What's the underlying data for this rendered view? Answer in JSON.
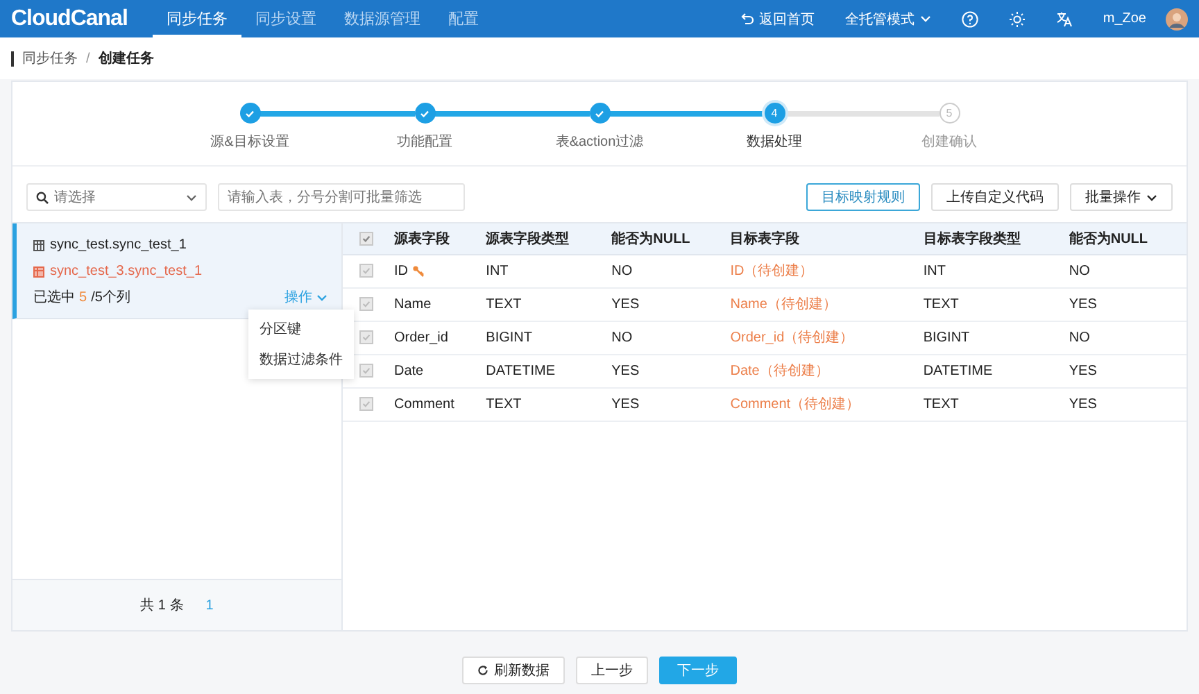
{
  "header": {
    "logo": "CloudCanal",
    "nav": [
      {
        "label": "同步任务",
        "selected": true
      },
      {
        "label": "同步设置",
        "selected": false
      },
      {
        "label": "数据源管理",
        "selected": false
      },
      {
        "label": "配置",
        "selected": false
      }
    ],
    "home_link": "返回首页",
    "mode": "全托管模式",
    "user": "m_Zoe"
  },
  "breadcrumb": {
    "items": [
      "同步任务",
      "创建任务"
    ],
    "separator": "/"
  },
  "steps": [
    {
      "label": "源&目标设置",
      "done": true,
      "selected": false
    },
    {
      "label": "功能配置",
      "done": true,
      "selected": false
    },
    {
      "label": "表&action过滤",
      "done": true,
      "selected": false
    },
    {
      "number": "4",
      "label": "数据处理",
      "done": false,
      "selected": true
    },
    {
      "number": "5",
      "label": "创建确认",
      "done": false,
      "selected": false
    }
  ],
  "toolbar": {
    "select_placeholder": "请选择",
    "filter_placeholder": "请输入表，分号分割可批量筛选",
    "buttons": [
      {
        "label": "目标映射规则",
        "kind": "outline"
      },
      {
        "label": "上传自定义代码",
        "kind": "plain"
      },
      {
        "label": "批量操作",
        "kind": "dropdown"
      }
    ]
  },
  "table_list": [
    {
      "source": "sync_test.sync_test_1",
      "target": "sync_test_3.sync_test_1",
      "selected_prefix": "已选中",
      "selected_count": "5",
      "selected_suffix": "/5个列",
      "action": "操作",
      "selected": true
    }
  ],
  "action_menu": [
    "分区键",
    "数据过滤条件"
  ],
  "pagination": {
    "total": "共 1 条",
    "page": "1"
  },
  "all_checked": true,
  "columns": [
    "源表字段",
    "源表字段类型",
    "能否为NULL",
    "目标表字段",
    "目标表字段类型",
    "能否为NULL"
  ],
  "rows": [
    {
      "checked": true,
      "key": true,
      "cells": [
        "ID",
        "INT",
        "NO",
        "ID（待创建）",
        "INT",
        "NO"
      ]
    },
    {
      "checked": true,
      "key": false,
      "cells": [
        "Name",
        "TEXT",
        "YES",
        "Name（待创建）",
        "TEXT",
        "YES"
      ]
    },
    {
      "checked": true,
      "key": false,
      "cells": [
        "Order_id",
        "BIGINT",
        "NO",
        "Order_id（待创建）",
        "BIGINT",
        "NO"
      ]
    },
    {
      "checked": true,
      "key": false,
      "cells": [
        "Date",
        "DATETIME",
        "YES",
        "Date（待创建）",
        "DATETIME",
        "YES"
      ]
    },
    {
      "checked": true,
      "key": false,
      "cells": [
        "Comment",
        "TEXT",
        "YES",
        "Comment（待创建）",
        "TEXT",
        "YES"
      ]
    }
  ],
  "footer_buttons": [
    {
      "label": "刷新数据",
      "kind": "refresh"
    },
    {
      "label": "上一步",
      "kind": "plain"
    },
    {
      "label": "下一步",
      "kind": "primary"
    }
  ]
}
